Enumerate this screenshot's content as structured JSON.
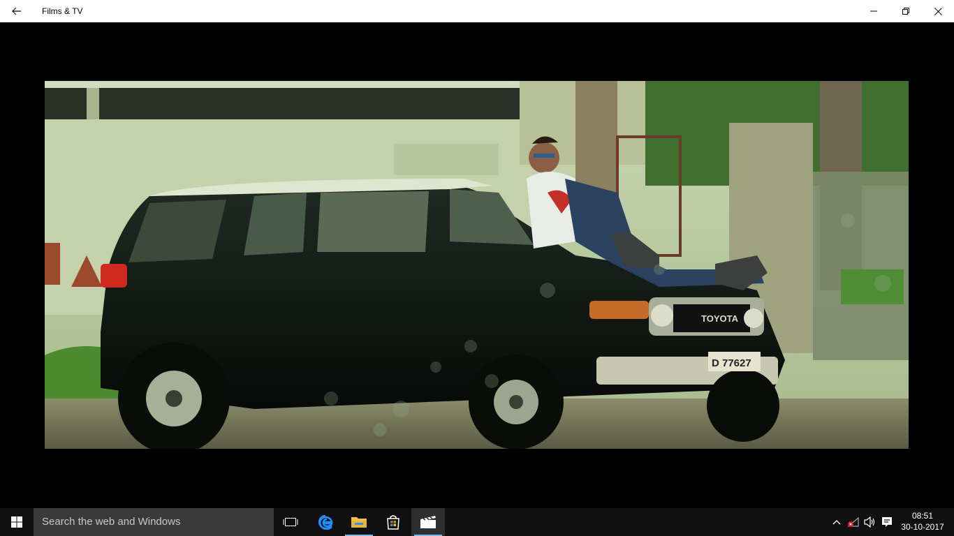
{
  "window": {
    "title": "Films & TV",
    "back_icon": "back-arrow-icon",
    "minimize_icon": "minimize-icon",
    "restore_icon": "restore-icon",
    "close_icon": "close-icon"
  },
  "video": {
    "plate_text": "D 77627",
    "brand_text": "TOYOTA"
  },
  "taskbar": {
    "search_placeholder": "Search the web and Windows",
    "pinned": [
      {
        "name": "task-view-icon"
      },
      {
        "name": "edge-icon"
      },
      {
        "name": "file-explorer-icon"
      },
      {
        "name": "store-icon"
      },
      {
        "name": "films-tv-icon",
        "active": true
      }
    ],
    "tray": [
      "chevron-up-icon",
      "network-icon",
      "volume-icon",
      "action-center-icon"
    ],
    "time": "08:51",
    "date": "30-10-2017"
  },
  "colors": {
    "titlebar_bg": "#ffffff",
    "player_bg": "#000000",
    "taskbar_bg": "#101010",
    "search_bg": "#3a3a3a",
    "accent": "#76b9ed"
  }
}
